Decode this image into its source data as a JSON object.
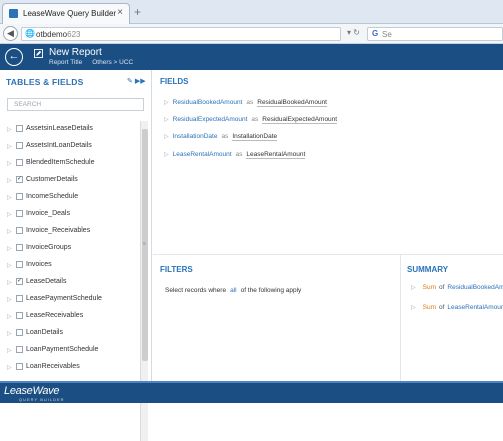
{
  "browser": {
    "tab_title": "LeaseWave Query Builder",
    "tab_close": "×",
    "new_tab": "+",
    "url_host": "otbdemo",
    "url_rest": "623",
    "search_placeholder": "Se"
  },
  "header": {
    "title": "New Report",
    "subtitle": "Report Title",
    "breadcrumb": "Others > UCC"
  },
  "left_panel": {
    "title": "TABLES & FIELDS",
    "search_placeholder": "SEARCH",
    "tables": [
      {
        "label": "AssetsinLeaseDetails",
        "checked": false
      },
      {
        "label": "AssetsIntLoanDetails",
        "checked": false
      },
      {
        "label": "BlendedItemSchedule",
        "checked": false
      },
      {
        "label": "CustomerDetails",
        "checked": true
      },
      {
        "label": "IncomeSchedule",
        "checked": false
      },
      {
        "label": "Invoice_Deals",
        "checked": false
      },
      {
        "label": "Invoice_Receivables",
        "checked": false
      },
      {
        "label": "InvoiceGroups",
        "checked": false
      },
      {
        "label": "Invoices",
        "checked": false
      },
      {
        "label": "LeaseDetails",
        "checked": true
      },
      {
        "label": "LeasePaymentSchedule",
        "checked": false
      },
      {
        "label": "LeaseReceivables",
        "checked": false
      },
      {
        "label": "LoanDetails",
        "checked": false
      },
      {
        "label": "LoanPaymentSchedule",
        "checked": false
      },
      {
        "label": "LoanReceivables",
        "checked": false
      }
    ]
  },
  "fields": {
    "title": "FIELDS",
    "as_label": "as",
    "items": [
      {
        "name": "ResidualBookedAmount",
        "alias": "ResidualBookedAmount"
      },
      {
        "name": "ResidualExpectedAmount",
        "alias": "ResidualExpectedAmount"
      },
      {
        "name": "InstallationDate",
        "alias": "InstallationDate"
      },
      {
        "name": "LeaseRentalAmount",
        "alias": "LeaseRentalAmount"
      }
    ]
  },
  "filters": {
    "title": "FILTERS",
    "prefix": "Select records where",
    "quantifier": "all",
    "suffix": "of the following apply"
  },
  "summary": {
    "title": "SUMMARY",
    "items": [
      {
        "fn": "Sum",
        "of": "of",
        "field": "ResidualBookedAmo"
      },
      {
        "fn": "Sum",
        "of": "of",
        "field": "LeaseRentalAmoun"
      }
    ]
  },
  "footer": {
    "logo": "LeaseWave",
    "logo_sub": "QUERY BUILDER"
  },
  "colors": {
    "brand_blue": "#1b4f83",
    "link_blue": "#2b73b8",
    "accent_orange": "#e07b16"
  }
}
